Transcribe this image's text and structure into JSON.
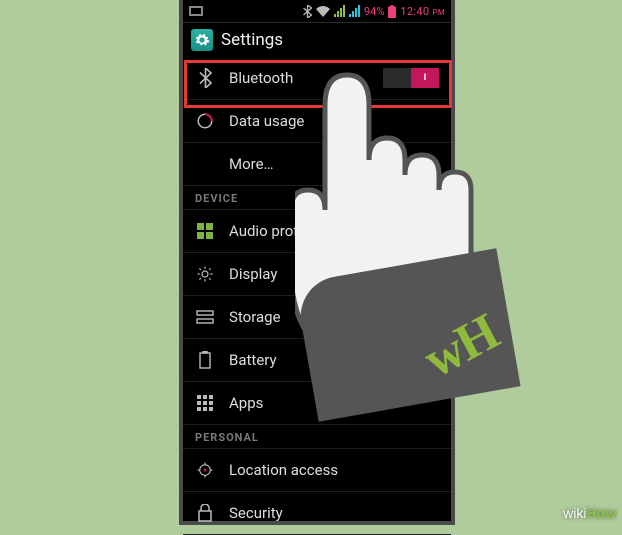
{
  "status": {
    "battery_pct": "94%",
    "clock": "12:40",
    "ampm": "PM"
  },
  "title": "Settings",
  "sections": {
    "wireless": [
      {
        "label": "Bluetooth",
        "toggle": "I"
      },
      {
        "label": "Data usage"
      },
      {
        "label": "More…"
      }
    ],
    "device_hdr": "DEVICE",
    "device": [
      {
        "label": "Audio profiles"
      },
      {
        "label": "Display"
      },
      {
        "label": "Storage"
      },
      {
        "label": "Battery"
      },
      {
        "label": "Apps"
      }
    ],
    "personal_hdr": "PERSONAL",
    "personal": [
      {
        "label": "Location access"
      },
      {
        "label": "Security"
      }
    ]
  },
  "watermark": {
    "a": "wiki",
    "b": "How"
  },
  "hand_logo": "wH"
}
